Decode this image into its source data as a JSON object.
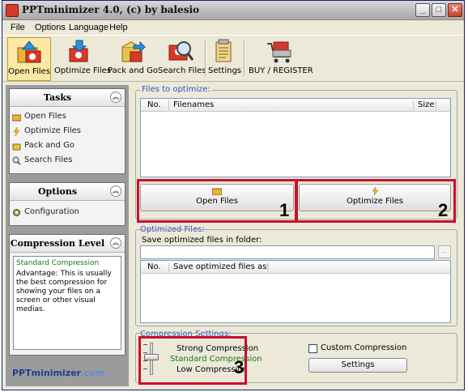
{
  "window": {
    "title": "PPTminimizer 4.0, (c) by balesio",
    "min": "_",
    "max": "□",
    "close": "✕"
  },
  "menu": [
    "File",
    "Options",
    "Language",
    "Help"
  ],
  "toolbar": {
    "open_files": "Open Files",
    "optimize_files": "Optimize Files",
    "pack_and_go": "Pack and Go",
    "search_files": "Search Files",
    "settings": "Settings",
    "buy_register": "BUY / REGISTER"
  },
  "tasks": {
    "title": "Tasks",
    "items": [
      "Open Files",
      "Optimize Files",
      "Pack and Go",
      "Search Files"
    ]
  },
  "options": {
    "title": "Options",
    "items": [
      "Configuration"
    ]
  },
  "compression_level": {
    "title": "Compression Level",
    "name": "Standard Compression",
    "description": "Advantage: This is usually the best compression for showing your files on a screen or other visual medias."
  },
  "logo": {
    "main": "PPTminimizer",
    "suffix": ".com"
  },
  "files_to_optimize": {
    "label": "Files to optimize:",
    "columns": [
      "No.",
      "Filenames",
      "Size"
    ],
    "rows": []
  },
  "buttons": {
    "open_files": "Open Files",
    "optimize_files": "Optimize Files"
  },
  "optimized_files": {
    "label": "Optimized Files:",
    "folder_label": "Save optimized files in folder:",
    "folder_value": "",
    "browse": "...",
    "columns": [
      "No.",
      "Save optimized files as:"
    ],
    "rows": []
  },
  "compression_settings": {
    "label": "Compression Settings:",
    "levels": [
      "Strong Compression",
      "Standard Compression",
      "Low Compression"
    ],
    "selected_level": "Standard Compression",
    "custom_label": "Custom Compression",
    "custom_checked": false,
    "settings_button": "Settings"
  },
  "callouts": [
    "1",
    "2",
    "3"
  ],
  "colors": {
    "accent_red": "#c8102e",
    "selected_level": "#127a12",
    "group_label": "#2a56c6"
  }
}
